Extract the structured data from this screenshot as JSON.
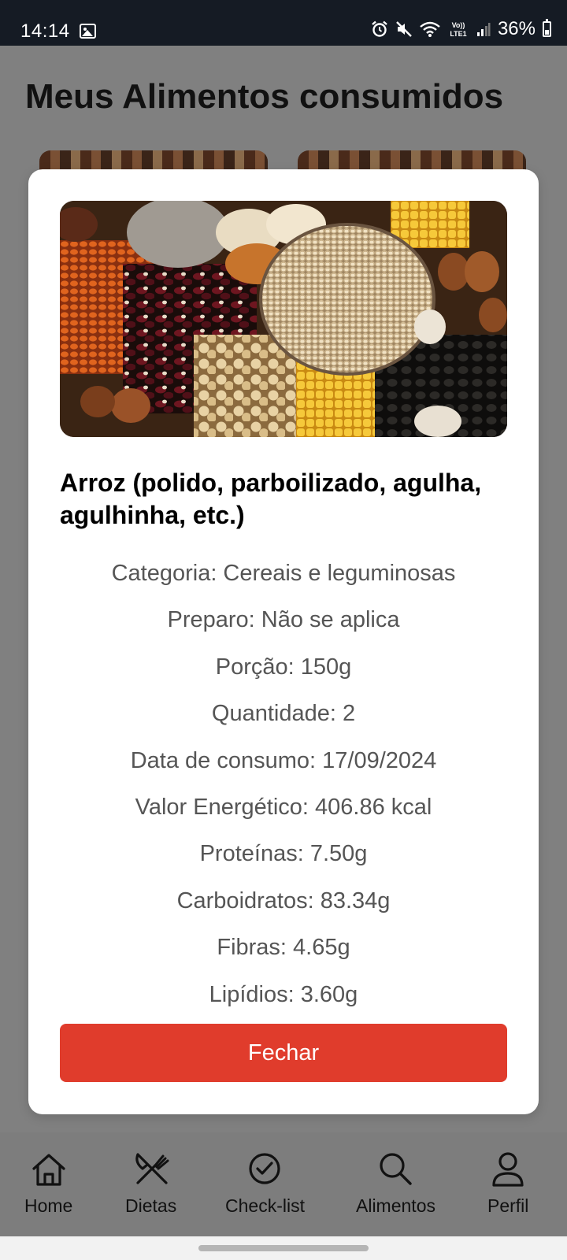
{
  "status_bar": {
    "time": "14:14",
    "battery": "36%",
    "battery_level": 0.36,
    "icons": [
      "gallery-icon",
      "alarm-icon",
      "mute-icon",
      "wifi-icon",
      "volte-icon",
      "signal-icon",
      "battery-icon"
    ],
    "volte_label_top": "Vo))",
    "volte_label_bottom": "LTE1"
  },
  "page": {
    "title": "Meus Alimentos consumidos"
  },
  "modal": {
    "image_icon": "food-image",
    "title": "Arroz (polido, parboilizado, agulha, agulhinha, etc.)",
    "rows": [
      "Categoria: Cereais e leguminosas",
      "Preparo: Não se aplica",
      "Porção: 150g",
      "Quantidade: 2",
      "Data de consumo: 17/09/2024",
      "Valor Energético: 406.86 kcal",
      "Proteínas: 7.50g",
      "Carboidratos: 83.34g",
      "Fibras: 4.65g",
      "Lipídios: 3.60g"
    ],
    "close_label": "Fechar",
    "close_color": "#e03c2c"
  },
  "bottom_nav": {
    "items": [
      {
        "label": "Home",
        "icon": "home-icon"
      },
      {
        "label": "Dietas",
        "icon": "utensils-icon"
      },
      {
        "label": "Check-list",
        "icon": "check-circle-icon"
      },
      {
        "label": "Alimentos",
        "icon": "search-icon"
      },
      {
        "label": "Perfil",
        "icon": "user-icon"
      }
    ]
  },
  "colors": {
    "overlay_background": "#808080",
    "status_bar": "#151b24",
    "accent": "#e03c2c"
  }
}
